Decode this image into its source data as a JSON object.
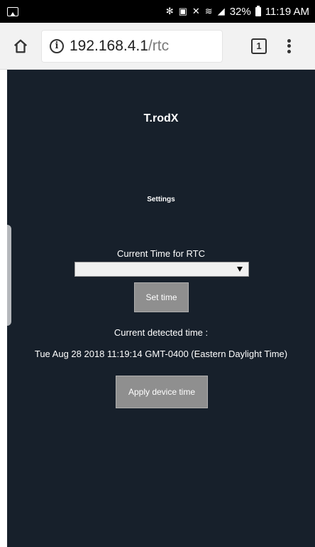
{
  "status_bar": {
    "icons": [
      "gallery-icon",
      "bluetooth-icon",
      "nfc-icon",
      "mute-icon",
      "wifi-icon",
      "signal-icon",
      "battery-icon"
    ],
    "battery": "32%",
    "time": "11:19 AM"
  },
  "browser": {
    "url_host": "192.168.4.1",
    "url_path": "/rtc",
    "tab_count": "1"
  },
  "page": {
    "app_title": "T.rodX",
    "section_title": "Settings",
    "rtc_label": "Current Time for RTC",
    "rtc_select_value": "",
    "set_time_label": "Set time",
    "detected_label": "Current detected time :",
    "detected_time": "Tue Aug 28 2018 11:19:14 GMT-0400 (Eastern Daylight Time)",
    "apply_label": "Apply device time"
  },
  "colors": {
    "page_background": "#17202b",
    "button_background": "#8f8f8f",
    "toolbar_background": "#f2f2f2"
  }
}
